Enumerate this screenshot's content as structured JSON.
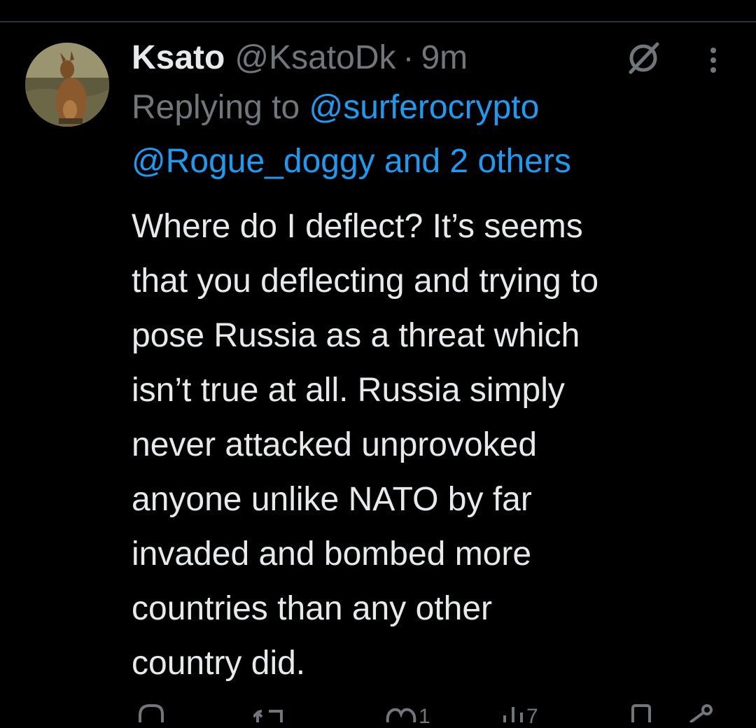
{
  "tweet": {
    "display_name": "Ksato",
    "handle": "@KsatoDk",
    "separator": "·",
    "time": "9m",
    "replying_prefix": "Replying to",
    "reply_to_1": "@surferocrypto",
    "reply_to_2": "@Rogue_doggy",
    "reply_joiner": " and ",
    "reply_others": "2 others",
    "body_lines": [
      "Where do I deflect? It’s seems",
      "that you deflecting and trying to",
      "pose Russia as a threat which",
      "isn’t true at all. Russia simply",
      "never attacked unprovoked",
      "anyone unlike NATO by far",
      "invaded and bombed more",
      "countries than any other",
      "country did."
    ]
  },
  "icons": {
    "header_right": [
      "slash-circle-icon",
      "more-vertical-icon"
    ],
    "actions": [
      "reply-icon",
      "retweet-icon",
      "like-icon",
      "views-icon",
      "bookmark-icon",
      "share-icon"
    ]
  },
  "actions": {
    "like_count": "1",
    "views_count": "7"
  },
  "colors": {
    "background": "#000000",
    "text": "#e7e9ea",
    "muted": "#71767b",
    "link": "#1d9bf0"
  }
}
